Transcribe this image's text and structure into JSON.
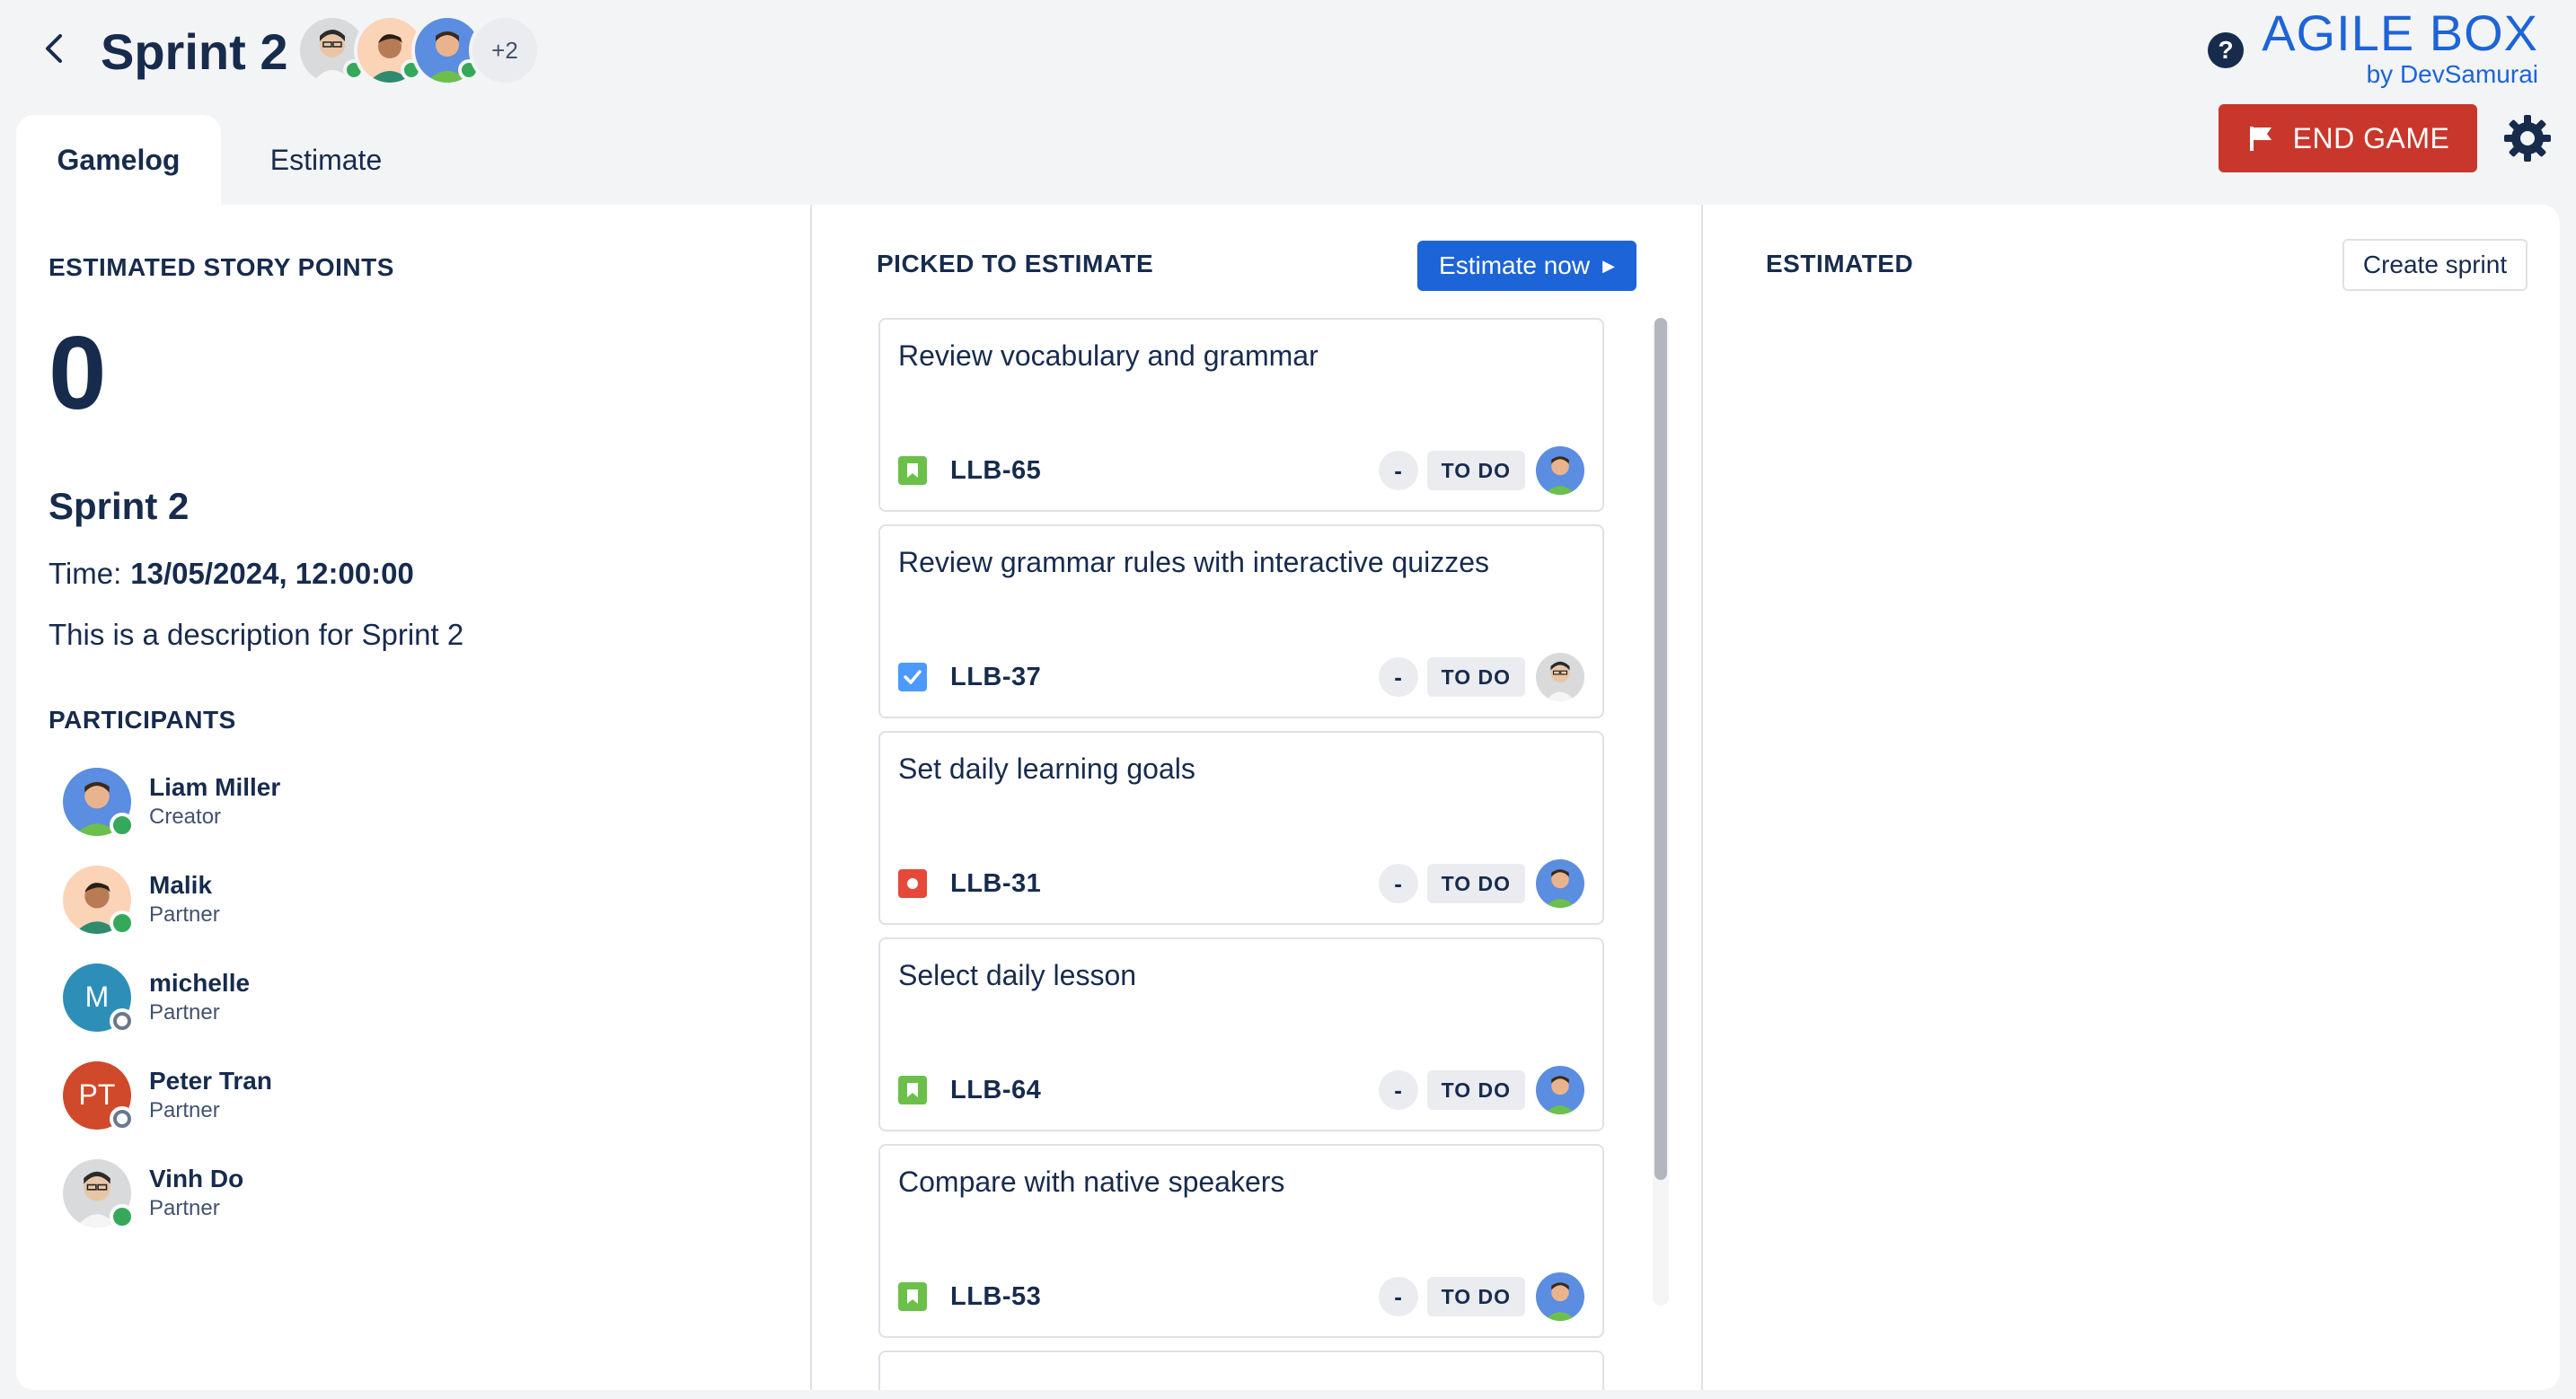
{
  "header": {
    "title": "Sprint 2",
    "avatars_more": "+2"
  },
  "brand": {
    "name": "AGILE BOX",
    "by": "by DevSamurai"
  },
  "actions": {
    "end_game": "END GAME"
  },
  "tabs": [
    {
      "label": "Gamelog",
      "active": true
    },
    {
      "label": "Estimate",
      "active": false
    }
  ],
  "summary": {
    "label": "ESTIMATED STORY POINTS",
    "points": "0",
    "sprint_name": "Sprint 2",
    "time_label": "Time:",
    "time_value": "13/05/2024, 12:00:00",
    "description": "This is a description for Sprint 2"
  },
  "participants": {
    "label": "PARTICIPANTS",
    "list": [
      {
        "name": "Liam Miller",
        "role": "Creator",
        "status": "online"
      },
      {
        "name": "Malik",
        "role": "Partner",
        "status": "online"
      },
      {
        "name": "michelle",
        "role": "Partner",
        "status": "offline",
        "initials": "M",
        "color": "#2d8fb8"
      },
      {
        "name": "Peter Tran",
        "role": "Partner",
        "status": "offline",
        "initials": "PT",
        "color": "#d0492a"
      },
      {
        "name": "Vinh Do",
        "role": "Partner",
        "status": "online"
      }
    ]
  },
  "picked": {
    "label": "PICKED TO ESTIMATE",
    "estimate_now": "Estimate now",
    "cards": [
      {
        "title": "Review vocabulary and grammar",
        "key": "LLB-65",
        "type": "story",
        "estimate": "-",
        "status": "TO DO",
        "assignee": "liam"
      },
      {
        "title": "Review grammar rules with interactive quizzes",
        "key": "LLB-37",
        "type": "task",
        "estimate": "-",
        "status": "TO DO",
        "assignee": "vinh"
      },
      {
        "title": "Set daily learning goals",
        "key": "LLB-31",
        "type": "bug",
        "estimate": "-",
        "status": "TO DO",
        "assignee": "liam"
      },
      {
        "title": "Select daily lesson",
        "key": "LLB-64",
        "type": "story",
        "estimate": "-",
        "status": "TO DO",
        "assignee": "liam"
      },
      {
        "title": "Compare with native speakers",
        "key": "LLB-53",
        "type": "story",
        "estimate": "-",
        "status": "TO DO",
        "assignee": "liam"
      }
    ]
  },
  "estimated": {
    "label": "ESTIMATED",
    "create_sprint": "Create sprint"
  },
  "colors": {
    "primary": "#1c64d8",
    "danger": "#c9372c",
    "online": "#36a85b",
    "story": "#6cc04a",
    "task": "#4c9aff",
    "bug": "#e5493a"
  }
}
